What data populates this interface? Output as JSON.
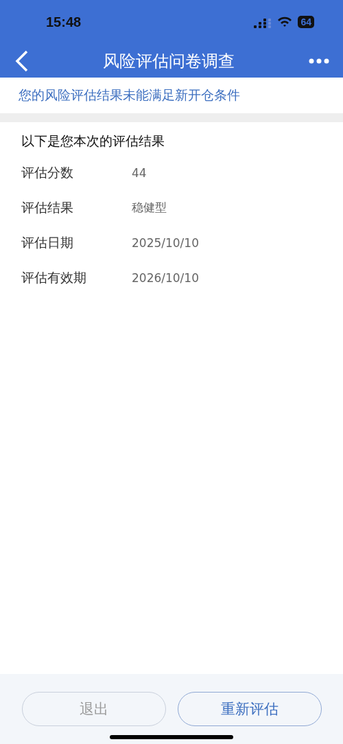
{
  "status_bar": {
    "time": "15:48",
    "battery": "64"
  },
  "nav": {
    "title": "风险评估问卷调查"
  },
  "notice": "您的风险评估结果未能满足新开仓条件",
  "result": {
    "heading": "以下是您本次的评估结果",
    "rows": [
      {
        "label": "评估分数",
        "value": "44"
      },
      {
        "label": "评估结果",
        "value": "稳健型"
      },
      {
        "label": "评估日期",
        "value": "2025/10/10"
      },
      {
        "label": "评估有效期",
        "value": "2026/10/10"
      }
    ]
  },
  "buttons": [
    {
      "label": "退出",
      "disabled": true
    },
    {
      "label": "重新评估",
      "disabled": false
    }
  ]
}
